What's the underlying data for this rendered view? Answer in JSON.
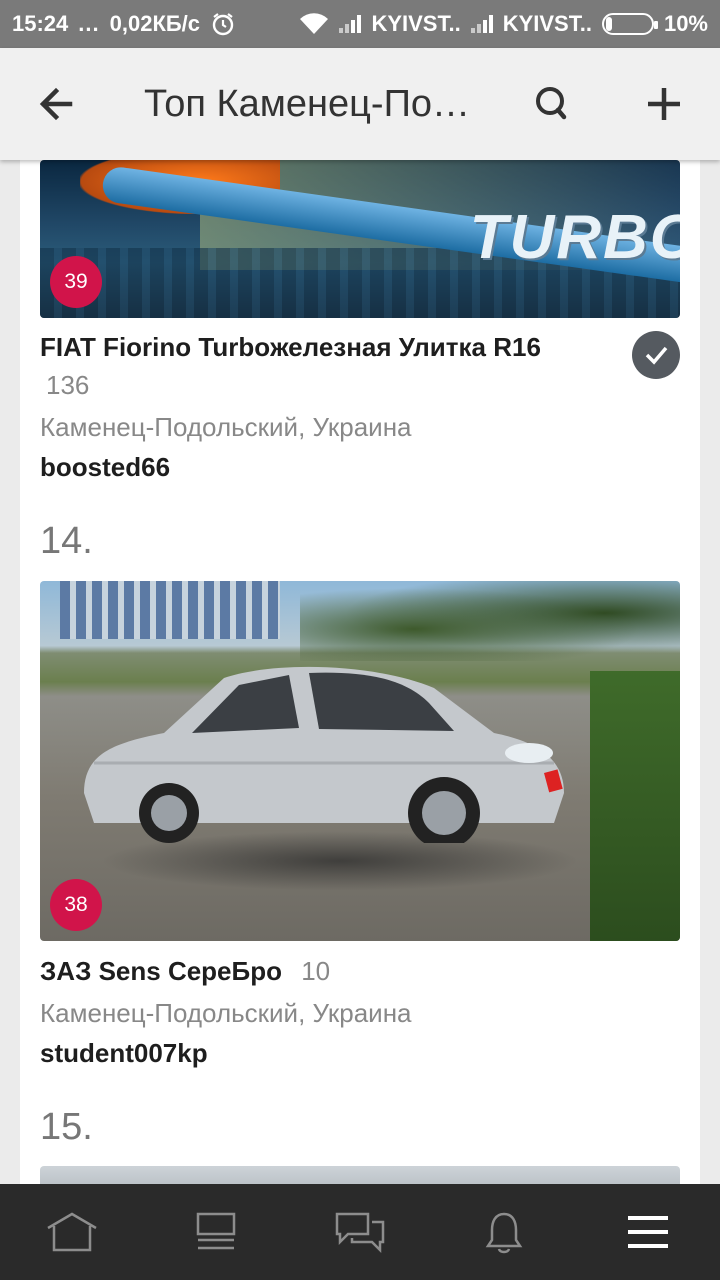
{
  "status_bar": {
    "time": "15:24",
    "dots": "...",
    "speed": "0,02КБ/с",
    "carrier1": "KYIVST..",
    "carrier2": "KYIVST..",
    "battery": "10%"
  },
  "app_bar": {
    "title": "Топ Каменец-По…",
    "back_icon": "arrow-left-icon",
    "search_icon": "search-icon",
    "add_icon": "plus-icon"
  },
  "entries": [
    {
      "badge": "39",
      "title": "FIAT Fiorino Turboжелезная Улитка R16",
      "likes": "136",
      "location": "Каменец-Подольский, Украина",
      "author": "boosted66",
      "photo_text": "TURBO",
      "checked": true
    },
    {
      "rank": "14.",
      "badge": "38",
      "title": "ЗАЗ Sens СереБро",
      "likes": "10",
      "location": "Каменец-Подольский, Украина",
      "author": "student007kp"
    },
    {
      "rank": "15."
    }
  ],
  "bottom_nav": {
    "items": [
      "home-icon",
      "feed-icon",
      "messages-icon",
      "notifications-icon",
      "menu-icon"
    ]
  },
  "colors": {
    "badge": "#d1144a",
    "status_bar": "#7a7a7a",
    "app_bar": "#f0f0f0",
    "bottom_nav": "#1e1e1e"
  }
}
